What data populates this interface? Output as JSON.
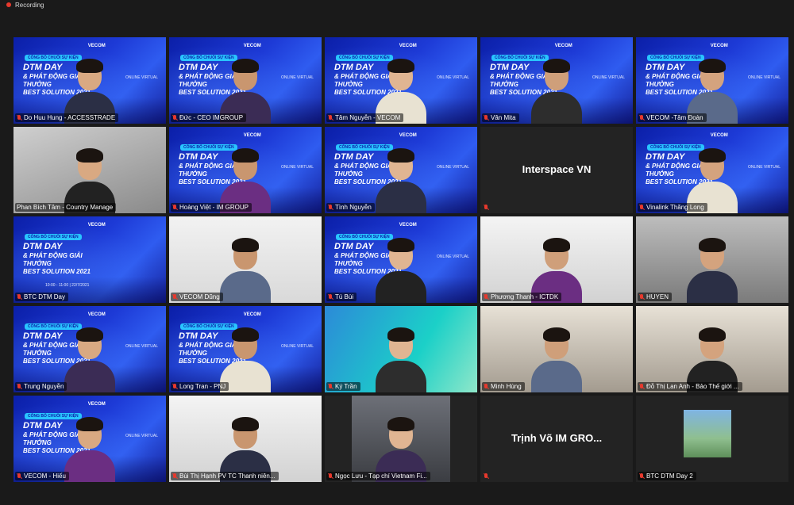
{
  "recording": {
    "label": "Recording"
  },
  "tiles": [
    {
      "name": "Do Huu Hung - ACCESSTRADE",
      "kind": "banner",
      "muted": true
    },
    {
      "name": "Đức - CEO IMGROUP",
      "kind": "banner",
      "muted": true
    },
    {
      "name": "Tâm Nguyễn - VECOM",
      "kind": "banner",
      "muted": true
    },
    {
      "name": "Vân Mita",
      "kind": "banner",
      "muted": true
    },
    {
      "name": "VECOM -Tâm Đoàn",
      "kind": "banner",
      "muted": true
    },
    {
      "name": "Phan Bích Tâm - Country Manage",
      "kind": "office",
      "muted": false,
      "active": true
    },
    {
      "name": "Hoàng Việt - IM GROUP",
      "kind": "banner",
      "muted": true
    },
    {
      "name": "Tình Nguyễn",
      "kind": "banner",
      "muted": true
    },
    {
      "name": "",
      "kind": "name-only",
      "display_name": "Interspace VN",
      "muted": true
    },
    {
      "name": "Vinalink Thăng Long",
      "kind": "banner",
      "muted": true
    },
    {
      "name": "BTC DTM Day",
      "kind": "banner-full",
      "muted": true
    },
    {
      "name": "VECOM Dũng",
      "kind": "vecom",
      "muted": true
    },
    {
      "name": "Tú Bùi",
      "kind": "banner",
      "muted": true
    },
    {
      "name": "Phương Thanh - ICTDK",
      "kind": "white",
      "muted": true
    },
    {
      "name": "HUYEN",
      "kind": "grey",
      "muted": true
    },
    {
      "name": "Trung Nguyễn",
      "kind": "banner",
      "muted": true
    },
    {
      "name": "Long Tran - PNJ",
      "kind": "banner",
      "muted": true
    },
    {
      "name": "Ký Trần",
      "kind": "web",
      "muted": true
    },
    {
      "name": "Minh Hùng",
      "kind": "room",
      "muted": true
    },
    {
      "name": "Đỗ Thị Lan Anh - Bảo Thế giới ...",
      "kind": "room",
      "muted": true
    },
    {
      "name": "VECOM - Hiếu",
      "kind": "banner",
      "muted": true
    },
    {
      "name": "Bùi Thị Hạnh PV TC Thanh niên...",
      "kind": "white",
      "muted": true
    },
    {
      "name": "Ngọc Lưu - Tạp chí Vietnam Fi...",
      "kind": "dark-video",
      "muted": true
    },
    {
      "name": "",
      "kind": "name-only",
      "display_name": "Trịnh Võ IM GRO...",
      "muted": true
    },
    {
      "name": "BTC DTM Day 2",
      "kind": "thumb",
      "muted": true
    }
  ],
  "banner": {
    "logo": "VECOM",
    "tag": "CÔNG BỐ CHUỖI SỰ KIỆN",
    "line1": "DTM DAY",
    "line2": "& PHÁT ĐỘNG GIẢI THƯỞNG",
    "line3": "BEST SOLUTION 2021",
    "side": "ONLINE VIRTUAL",
    "time": "10:00 - 11:00 | 22/7/2021"
  },
  "colors": {
    "background": "#1a1a1a",
    "active_border": "#cde65a",
    "muted_mic": "#e8392d",
    "banner_blue": "#1d3ad6"
  }
}
